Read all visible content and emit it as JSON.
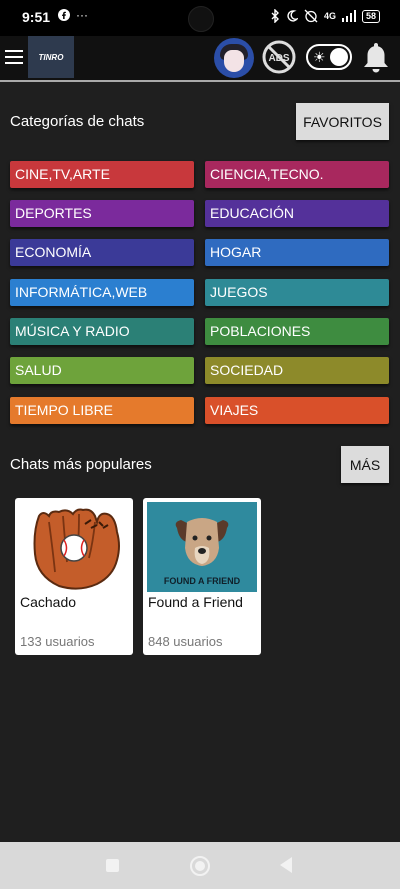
{
  "status_bar": {
    "time": "9:51",
    "left_icons": [
      "facebook-icon",
      "more-icon"
    ],
    "network": "4G",
    "battery": "58"
  },
  "app": {
    "logo_text": "TINRO",
    "ads_label": "ADS"
  },
  "categories_section": {
    "title": "Categorías de chats",
    "favorites_button": "FAVORITOS"
  },
  "categories": [
    {
      "label": "CINE,TV,ARTE",
      "color": "#c8383c"
    },
    {
      "label": "CIENCIA,TECNO.",
      "color": "#a8285e"
    },
    {
      "label": "DEPORTES",
      "color": "#7b2a9c"
    },
    {
      "label": "EDUCACIÓN",
      "color": "#54319a"
    },
    {
      "label": "ECONOMÍA",
      "color": "#3b3a98"
    },
    {
      "label": "HOGAR",
      "color": "#2f6bc0"
    },
    {
      "label": "INFORMÁTICA,WEB",
      "color": "#2b7fd0"
    },
    {
      "label": "JUEGOS",
      "color": "#2e8a96"
    },
    {
      "label": "MÚSICA Y RADIO",
      "color": "#2b8076"
    },
    {
      "label": "POBLACIONES",
      "color": "#3e8c40"
    },
    {
      "label": "SALUD",
      "color": "#6ea33b"
    },
    {
      "label": "SOCIEDAD",
      "color": "#8d8a2a"
    },
    {
      "label": "TIEMPO LIBRE",
      "color": "#e57a2c"
    },
    {
      "label": "VIAJES",
      "color": "#d9502a"
    }
  ],
  "popular_section": {
    "title": "Chats más populares",
    "more_button": "MÁS"
  },
  "popular_chats": [
    {
      "name": "Cachado",
      "users": "133 usuarios"
    },
    {
      "name": "Found a Friend",
      "users": "848 usuarios",
      "image_text": "FOUND A FRIEND"
    }
  ]
}
